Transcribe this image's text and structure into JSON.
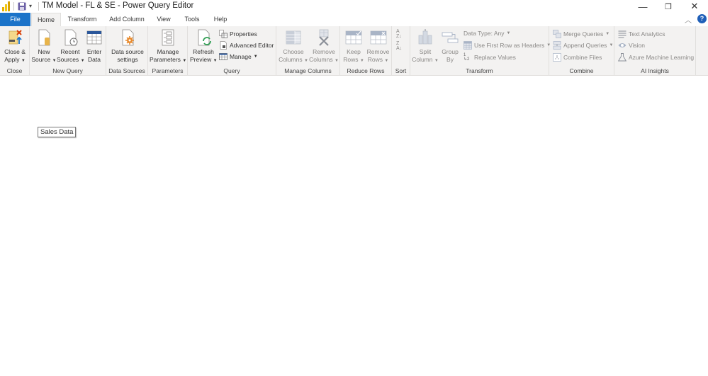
{
  "window": {
    "title": "TM Model - FL & SE - Power Query Editor",
    "controls": {
      "minimize": "—",
      "restore": "❐",
      "close": "✕"
    }
  },
  "tabs": [
    {
      "label": "File"
    },
    {
      "label": "Home"
    },
    {
      "label": "Transform"
    },
    {
      "label": "Add Column"
    },
    {
      "label": "View"
    },
    {
      "label": "Tools"
    },
    {
      "label": "Help"
    }
  ],
  "ribbon": {
    "close": {
      "label": "Close",
      "close_apply": [
        "Close &",
        "Apply"
      ]
    },
    "new_query": {
      "label": "New Query",
      "new_source": [
        "New",
        "Source"
      ],
      "recent_sources": [
        "Recent",
        "Sources"
      ],
      "enter_data": [
        "Enter",
        "Data"
      ]
    },
    "data_sources": {
      "label": "Data Sources",
      "settings": [
        "Data source",
        "settings"
      ]
    },
    "parameters": {
      "label": "Parameters",
      "manage": [
        "Manage",
        "Parameters"
      ]
    },
    "query": {
      "label": "Query",
      "refresh": [
        "Refresh",
        "Preview"
      ],
      "properties": "Properties",
      "advanced_editor": "Advanced Editor",
      "manage": "Manage"
    },
    "manage_columns": {
      "label": "Manage Columns",
      "choose": [
        "Choose",
        "Columns"
      ],
      "remove": [
        "Remove",
        "Columns"
      ]
    },
    "reduce_rows": {
      "label": "Reduce Rows",
      "keep": [
        "Keep",
        "Rows"
      ],
      "remove": [
        "Remove",
        "Rows"
      ]
    },
    "sort": {
      "label": "Sort"
    },
    "transform": {
      "label": "Transform",
      "split": [
        "Split",
        "Column"
      ],
      "group": [
        "Group",
        "By"
      ],
      "data_type": "Data Type: Any",
      "first_row": "Use First Row as Headers",
      "replace": "Replace Values"
    },
    "combine": {
      "label": "Combine",
      "merge": "Merge Queries",
      "append": "Append Queries",
      "combine_files": "Combine Files"
    },
    "ai_insights": {
      "label": "AI Insights",
      "text_analytics": "Text Analytics",
      "vision": "Vision",
      "azure_ml": "Azure Machine Learning"
    }
  },
  "tooltip": {
    "text": "Sales Data"
  },
  "colors": {
    "file_tab": "#1b73c9",
    "ribbon_bg": "#f3f2f1",
    "accent_orange": "#e8892b",
    "help_blue": "#1f5fb8"
  }
}
